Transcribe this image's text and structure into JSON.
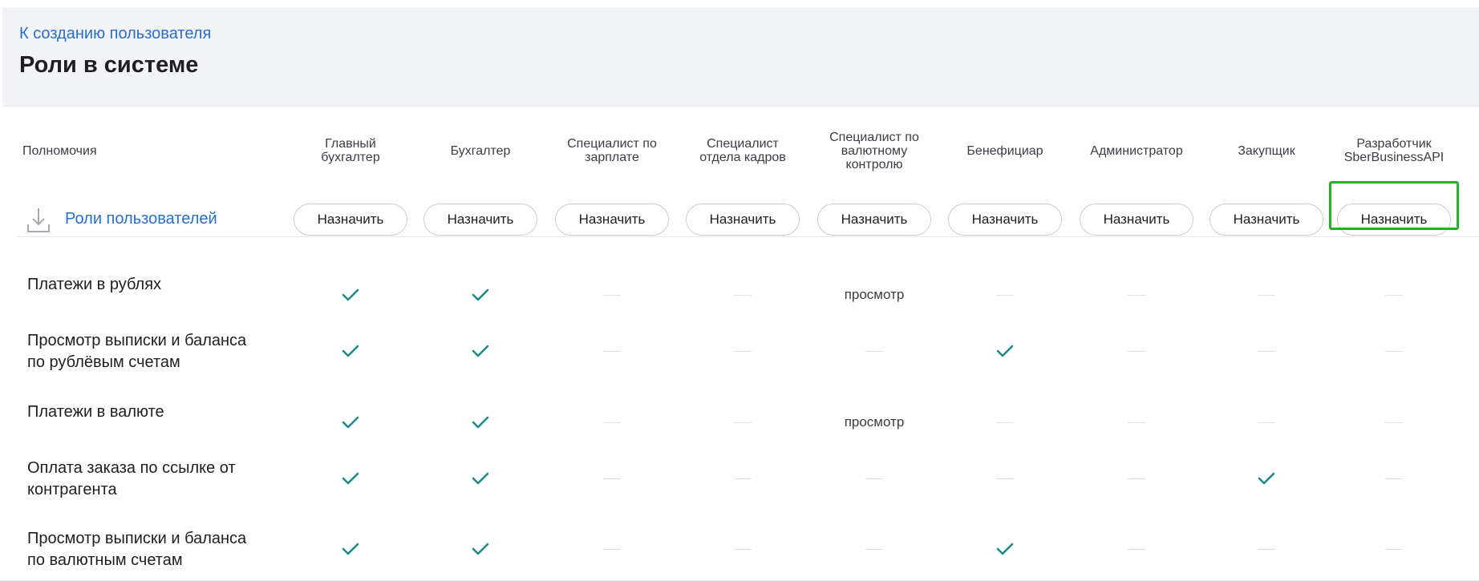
{
  "header": {
    "back_link": "К созданию пользователя",
    "title": "Роли в системе"
  },
  "table": {
    "first_column": "Полномочия",
    "columns": [
      "Главный\nбухгалтер",
      "Бухгалтер",
      "Специалист по\nзарплате",
      "Специалист\nотдела кадров",
      "Специалист по\nвалютному\nконтролю",
      "Бенефициар",
      "Администратор",
      "Закупщик",
      "Разработчик\nSberBusinessAPI"
    ],
    "roles_row_label": "Роли пользователей",
    "assign_label": "Назначить",
    "highlighted_column": 8,
    "rows": [
      {
        "label": "Платежи в рублях",
        "cells": [
          "check",
          "check",
          "dash",
          "dash",
          "text:просмотр",
          "dash",
          "dash",
          "dash",
          "dash"
        ]
      },
      {
        "label": "Просмотр выписки и баланса\nпо рублёвым счетам",
        "cells": [
          "check",
          "check",
          "dash",
          "dash",
          "dash",
          "check",
          "dash",
          "dash",
          "dash"
        ]
      },
      {
        "label": "Платежи в валюте",
        "cells": [
          "check",
          "check",
          "dash",
          "dash",
          "text:просмотр",
          "dash",
          "dash",
          "dash",
          "dash"
        ]
      },
      {
        "label": "Оплата заказа по ссылке от\nконтрагента",
        "cells": [
          "check",
          "check",
          "dash",
          "dash",
          "dash",
          "dash",
          "dash",
          "check",
          "dash"
        ]
      },
      {
        "label": "Просмотр выписки и баланса\nпо валютным счетам",
        "cells": [
          "check",
          "check",
          "dash",
          "dash",
          "dash",
          "check",
          "dash",
          "dash",
          "dash"
        ]
      }
    ]
  },
  "colors": {
    "link": "#2a6ec9",
    "check": "#1f8a8a",
    "highlight": "#27b02a",
    "header_bg": "#f2f4f7"
  },
  "icons": {
    "roles_row": "download-icon",
    "cell_yes": "check-icon"
  }
}
